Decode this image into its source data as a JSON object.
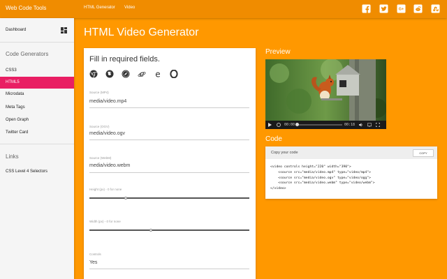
{
  "app": {
    "title": "Web Code Tools",
    "nav": [
      "HTML Generator",
      "Video"
    ]
  },
  "social_icons": [
    "facebook-icon",
    "twitter-icon",
    "google-plus-icon",
    "reddit-icon",
    "stumbleupon-icon"
  ],
  "sidebar": {
    "dashboard": "Dashboard",
    "generators_heading": "Code Generators",
    "items": [
      {
        "label": "CSS3",
        "active": false
      },
      {
        "label": "HTML5",
        "active": true
      },
      {
        "label": "Microdata",
        "active": false
      },
      {
        "label": "Meta Tags",
        "active": false
      },
      {
        "label": "Open Graph",
        "active": false
      },
      {
        "label": "Twitter Card",
        "active": false
      }
    ],
    "links_heading": "Links",
    "links": [
      "CSS Level 4 Selectors"
    ]
  },
  "main": {
    "title": "HTML Video Generator",
    "form": {
      "heading": "Fill in required fields.",
      "browsers": [
        "chrome-icon",
        "firefox-icon",
        "safari-icon",
        "ie-icon",
        "edge-icon",
        "opera-icon"
      ],
      "fields": [
        {
          "label": "Source (MP4)",
          "value": "media/video.mp4"
        },
        {
          "label": "Source (OGV)",
          "value": "media/video.ogv"
        },
        {
          "label": "Source (WebM)",
          "value": "media/video.webm"
        }
      ],
      "height_label": "Height (px) - 0 for none",
      "height_level": 0.23,
      "width_label": "Width (px) - 0 for none",
      "width_level": 0.39,
      "controls_label": "Controls",
      "controls_value": "Yes"
    },
    "preview": {
      "title": "Preview",
      "current_time": "00:00",
      "duration": "00:18",
      "progress": 0.02
    },
    "code": {
      "title": "Code",
      "header": "Copy your code",
      "copy_button": "COPY",
      "lines": [
        "<video controls height=\"220\" width=\"390\">",
        "    <source src=\"media/video.mp4\" type=\"video/mp4\">",
        "    <source src=\"media/video.ogv\" type=\"video/ogg\">",
        "    <source src=\"media/video.webm\" type=\"video/webm\">",
        "</video>"
      ]
    }
  },
  "colors": {
    "accent": "#ff9800",
    "topbar": "#f08c00",
    "active": "#e91e63"
  }
}
